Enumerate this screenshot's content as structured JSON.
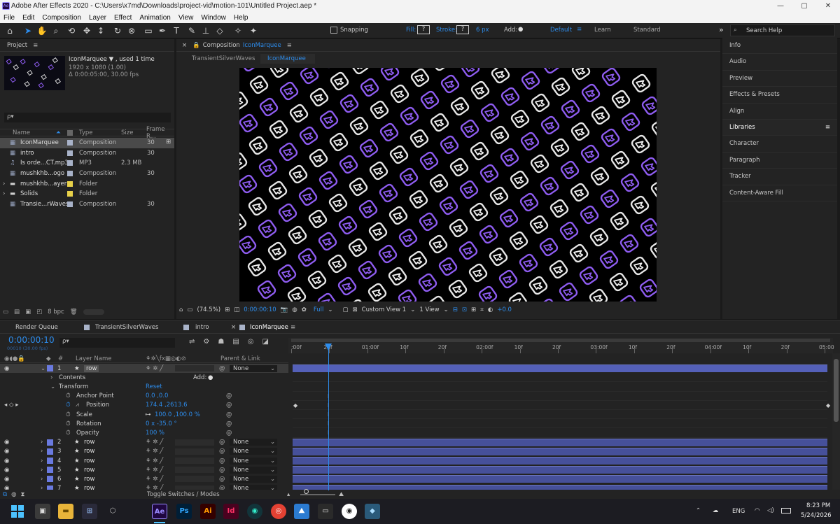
{
  "window": {
    "title": "Adobe After Effects 2020 - C:\\Users\\x7md\\Downloads\\project-vid\\motion-101\\Untitled Project.aep *",
    "minimize": "—",
    "maximize": "▢",
    "close": "✕"
  },
  "menu": [
    "File",
    "Edit",
    "Composition",
    "Layer",
    "Effect",
    "Animation",
    "View",
    "Window",
    "Help"
  ],
  "toolbar": {
    "snapping": "Snapping",
    "fill": "Fill:",
    "fill_val": "?",
    "stroke": "Stroke:",
    "stroke_val": "?",
    "stroke_px": "6 px",
    "add": "Add:",
    "workspaces": [
      "Default",
      "Learn",
      "Standard"
    ],
    "search_placeholder": "Search Help"
  },
  "project": {
    "title": "Project",
    "selected_name": "IconMarquee",
    "used": ", used 1 time",
    "res": "1920 x 1080 (1.00)",
    "dur": "Δ 0:00:05:00, 30.00 fps",
    "search_placeholder": "ρ▾",
    "columns": [
      "Name",
      "Type",
      "Size",
      "Frame R..."
    ],
    "items": [
      {
        "name": "IconMarquee",
        "type": "Composition",
        "size": "",
        "fr": "30",
        "color": "#a9b3c9",
        "icon": "comp"
      },
      {
        "name": "intro",
        "type": "Composition",
        "size": "",
        "fr": "30",
        "color": "#a9b3c9",
        "icon": "comp"
      },
      {
        "name": "Is orde...CT.mp3",
        "type": "MP3",
        "size": "2.3 MB",
        "fr": "",
        "color": "#a9b3c9",
        "icon": "audio"
      },
      {
        "name": "mushkhb...ogo",
        "type": "Composition",
        "size": "",
        "fr": "30",
        "color": "#a9b3c9",
        "icon": "comp"
      },
      {
        "name": "mushkhb...ayers",
        "type": "Folder",
        "size": "",
        "fr": "",
        "color": "#e8d14a",
        "icon": "folder"
      },
      {
        "name": "Solids",
        "type": "Folder",
        "size": "",
        "fr": "",
        "color": "#e8d14a",
        "icon": "folder"
      },
      {
        "name": "Transie...rWaves",
        "type": "Composition",
        "size": "",
        "fr": "30",
        "color": "#a9b3c9",
        "icon": "comp"
      }
    ],
    "bpc": "8 bpc"
  },
  "comp": {
    "header": "Composition",
    "name": "IconMarquee",
    "tabs": [
      "TransientSilverWaves",
      "IconMarquee"
    ],
    "zoom": "(74.5%)",
    "time": "0:00:00:10",
    "quality": "Full",
    "view": "Custom View 1",
    "views": "1 View",
    "exposure": "+0.0"
  },
  "right_panels": [
    "Info",
    "Audio",
    "Preview",
    "Effects & Presets",
    "Align",
    "Libraries",
    "Character",
    "Paragraph",
    "Tracker",
    "Content-Aware Fill"
  ],
  "timeline": {
    "tabs": [
      "Render Queue",
      "TransientSilverWaves",
      "intro",
      "IconMarquee"
    ],
    "current_time": "0:00:00:10",
    "fps_sub": "00010 (30.00 fps)",
    "col_layer": "Layer Name",
    "col_parent": "Parent & Link",
    "ruler": [
      ":00f",
      "20f",
      "01:00f",
      "10f",
      "20f",
      "02:00f",
      "10f",
      "20f",
      "03:00f",
      "10f",
      "20f",
      "04:00f",
      "10f",
      "20f",
      "05:00"
    ],
    "layer1": {
      "num": "1",
      "name": "row",
      "parent": "None"
    },
    "contents": "Contents",
    "add": "Add:",
    "transform": "Transform",
    "reset": "Reset",
    "props": [
      {
        "name": "Anchor Point",
        "value": "0.0 ,0.0"
      },
      {
        "name": "Position",
        "value": "174.4 ,2613.6"
      },
      {
        "name": "Scale",
        "value": "100.0 ,100.0 %"
      },
      {
        "name": "Rotation",
        "value": "0 x -35.0 °"
      },
      {
        "name": "Opacity",
        "value": "100 %"
      }
    ],
    "layers": [
      {
        "num": "2",
        "name": "row",
        "parent": "None"
      },
      {
        "num": "3",
        "name": "row",
        "parent": "None"
      },
      {
        "num": "4",
        "name": "row",
        "parent": "None"
      },
      {
        "num": "5",
        "name": "row",
        "parent": "None"
      },
      {
        "num": "6",
        "name": "row",
        "parent": "None"
      },
      {
        "num": "7",
        "name": "row",
        "parent": "None"
      }
    ],
    "toggle": "Toggle Switches / Modes"
  },
  "taskbar": {
    "lang": "ENG",
    "time": "8:23 PM",
    "date": "5/24/2026",
    "apps": [
      "Ae",
      "Ps",
      "Ai",
      "Id"
    ]
  },
  "colors": {
    "accent": "#2d8ceb",
    "layer_bar": "#46509a",
    "purple": "#8e5cf0"
  }
}
